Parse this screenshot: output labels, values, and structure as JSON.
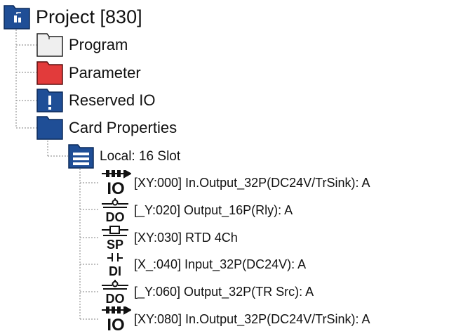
{
  "tree": {
    "root": {
      "label": "Project [830]",
      "icon": "project-folder-icon",
      "color": "#1f4e96"
    },
    "children": [
      {
        "label": "Program",
        "icon": "folder-icon",
        "color": "#efefef"
      },
      {
        "label": "Parameter",
        "icon": "folder-icon",
        "color": "#e23b3b"
      },
      {
        "label": "Reserved IO",
        "icon": "folder-exclamation-icon",
        "color": "#1f4e96"
      },
      {
        "label": "Card Properties",
        "icon": "folder-icon",
        "color": "#1f4e96"
      }
    ],
    "card_properties": {
      "local": {
        "label": "Local: 16 Slot",
        "icon": "rack-list-icon",
        "color": "#1f4e96"
      },
      "modules": [
        {
          "label": "[XY:000] In.Output_32P(DC24V/TrSink): A",
          "badge": "IO",
          "icon": "io-module-icon"
        },
        {
          "label": "[_Y:020] Output_16P(Rly): A",
          "badge": "DO",
          "icon": "do-module-icon"
        },
        {
          "label": "[XY:030] RTD 4Ch",
          "badge": "SP",
          "icon": "sp-module-icon"
        },
        {
          "label": "[X_:040] Input_32P(DC24V): A",
          "badge": "DI",
          "icon": "di-module-icon"
        },
        {
          "label": "[_Y:060] Output_32P(TR Src): A",
          "badge": "DO",
          "icon": "do-module-icon"
        },
        {
          "label": "[XY:080] In.Output_32P(DC24V/TrSink): A",
          "badge": "IO",
          "icon": "io-module-icon"
        }
      ]
    }
  }
}
